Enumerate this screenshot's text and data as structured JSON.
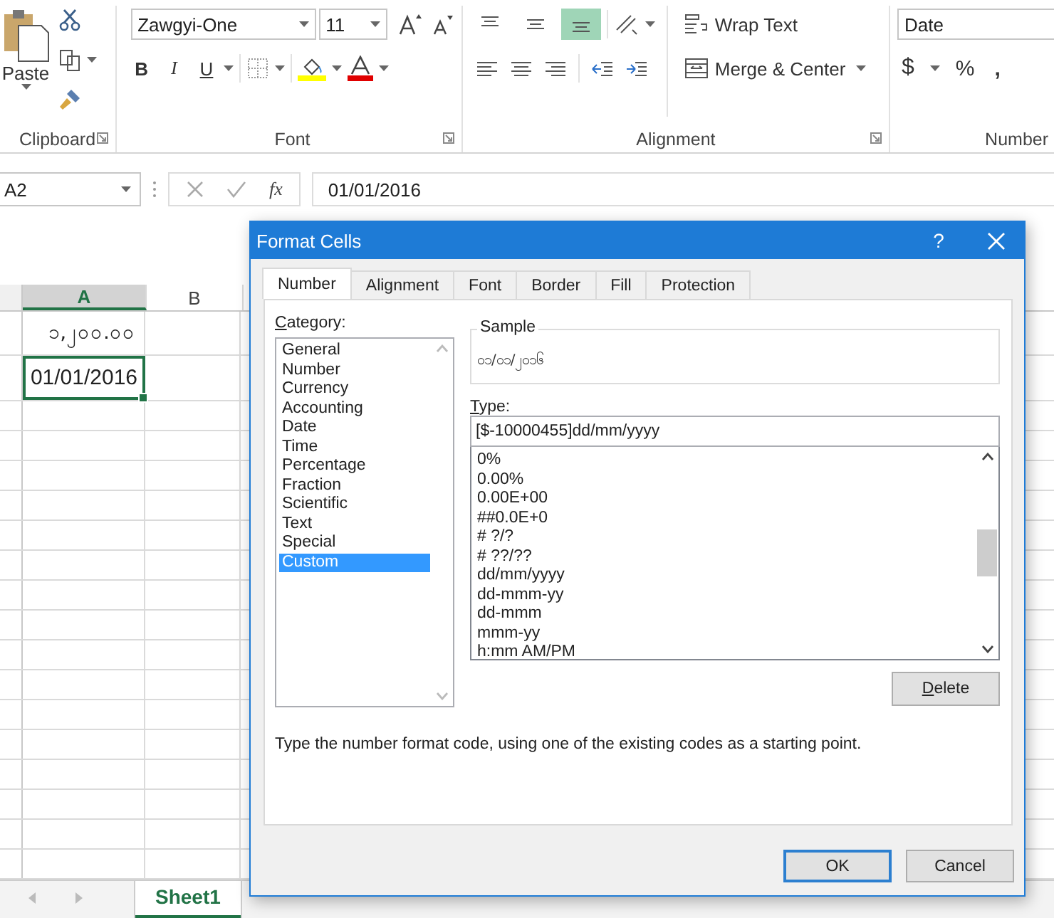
{
  "ribbon": {
    "clipboard": {
      "paste": "Paste",
      "label": "Clipboard"
    },
    "font": {
      "font_name": "Zawgyi-One",
      "font_size": "11",
      "bold": "B",
      "italic": "I",
      "underline": "U",
      "label": "Font"
    },
    "alignment": {
      "vertical": [
        {
          "kind": "top",
          "selected": false
        },
        {
          "kind": "middle",
          "selected": false
        },
        {
          "kind": "bottom",
          "selected": true
        }
      ],
      "wrap_text": "Wrap Text",
      "merge_center": "Merge & Center",
      "label": "Alignment"
    },
    "number": {
      "format": "Date",
      "currency": "$",
      "percent": "%",
      "comma": ",",
      "label": "Number"
    }
  },
  "formula_bar": {
    "name_box": "A2",
    "fx": "fx",
    "formula": "01/01/2016"
  },
  "sheet": {
    "columns": [
      {
        "label": "A",
        "selected": true
      },
      {
        "label": "B",
        "selected": false
      }
    ],
    "cells": [
      {
        "text": "၁,၂၀၀.၀၀",
        "selected": false
      },
      {
        "text": "01/01/2016",
        "selected": true
      }
    ],
    "tabs": [
      {
        "label": "Sheet1",
        "selected": true
      }
    ]
  },
  "dialog": {
    "title": "Format Cells",
    "help": "?",
    "tabs": [
      {
        "label": "Number",
        "selected": true
      },
      {
        "label": "Alignment",
        "selected": false
      },
      {
        "label": "Font",
        "selected": false
      },
      {
        "label": "Border",
        "selected": false
      },
      {
        "label": "Fill",
        "selected": false
      },
      {
        "label": "Protection",
        "selected": false
      }
    ],
    "category_label": "Category:",
    "categories": [
      {
        "label": "General",
        "selected": false
      },
      {
        "label": "Number",
        "selected": false
      },
      {
        "label": "Currency",
        "selected": false
      },
      {
        "label": "Accounting",
        "selected": false
      },
      {
        "label": "Date",
        "selected": false
      },
      {
        "label": "Time",
        "selected": false
      },
      {
        "label": "Percentage",
        "selected": false
      },
      {
        "label": "Fraction",
        "selected": false
      },
      {
        "label": "Scientific",
        "selected": false
      },
      {
        "label": "Text",
        "selected": false
      },
      {
        "label": "Special",
        "selected": false
      },
      {
        "label": "Custom",
        "selected": true
      }
    ],
    "sample_label": "Sample",
    "sample": "၀၁/၀၁/၂၀၁၆",
    "type_label": "Type:",
    "type_value": "[$-10000455]dd/mm/yyyy",
    "formats": [
      "0%",
      "0.00%",
      "0.00E+00",
      "##0.0E+0",
      "# ?/?",
      "# ??/??",
      "dd/mm/yyyy",
      "dd-mmm-yy",
      "dd-mmm",
      "mmm-yy",
      "h:mm AM/PM"
    ],
    "delete": "Delete",
    "description": "Type the number format code, using one of the existing codes as a starting point.",
    "buttons": [
      {
        "label": "OK",
        "default": true
      },
      {
        "label": "Cancel",
        "default": false
      }
    ]
  }
}
